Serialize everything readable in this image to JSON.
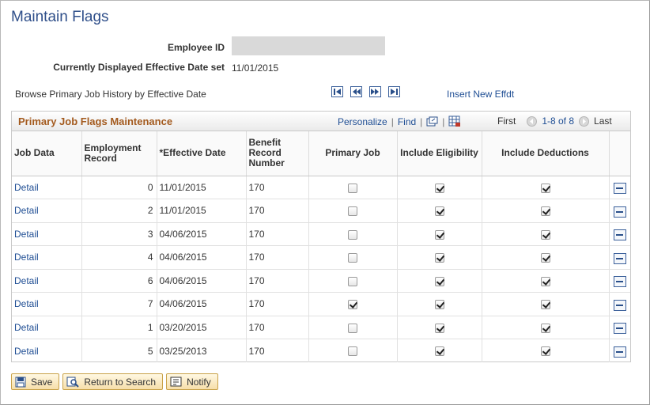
{
  "page": {
    "title": "Maintain Flags",
    "employee_id_label": "Employee ID",
    "employee_id_value": "",
    "effective_date_set_label": "Currently Displayed Effective Date set",
    "effective_date_set_value": "11/01/2015",
    "browse_label": "Browse Primary Job History by Effective Date",
    "insert_link": "Insert New Effdt"
  },
  "nav_icons": [
    "first-record-icon",
    "previous-record-icon",
    "next-record-icon",
    "last-record-icon"
  ],
  "grid": {
    "title": "Primary Job Flags Maintenance",
    "personalize": "Personalize",
    "separator": "|",
    "find": "Find",
    "first": "First",
    "range": "1-8 of 8",
    "last": "Last",
    "columns": {
      "job_data": "Job Data",
      "employment_record": "Employment Record",
      "effective_date": "*Effective Date",
      "benefit_record_number": "Benefit Record Number",
      "primary_job": "Primary Job",
      "include_eligibility": "Include Eligibility",
      "include_deductions": "Include Deductions"
    },
    "rows": [
      {
        "link": "Detail",
        "emp_rcd": "0",
        "eff_date": "11/01/2015",
        "ben_rcd": "170",
        "primary_job": false,
        "eligibility": true,
        "deductions": true
      },
      {
        "link": "Detail",
        "emp_rcd": "2",
        "eff_date": "11/01/2015",
        "ben_rcd": "170",
        "primary_job": false,
        "eligibility": true,
        "deductions": true
      },
      {
        "link": "Detail",
        "emp_rcd": "3",
        "eff_date": "04/06/2015",
        "ben_rcd": "170",
        "primary_job": false,
        "eligibility": true,
        "deductions": true
      },
      {
        "link": "Detail",
        "emp_rcd": "4",
        "eff_date": "04/06/2015",
        "ben_rcd": "170",
        "primary_job": false,
        "eligibility": true,
        "deductions": true
      },
      {
        "link": "Detail",
        "emp_rcd": "6",
        "eff_date": "04/06/2015",
        "ben_rcd": "170",
        "primary_job": false,
        "eligibility": true,
        "deductions": true
      },
      {
        "link": "Detail",
        "emp_rcd": "7",
        "eff_date": "04/06/2015",
        "ben_rcd": "170",
        "primary_job": true,
        "eligibility": true,
        "deductions": true
      },
      {
        "link": "Detail",
        "emp_rcd": "1",
        "eff_date": "03/20/2015",
        "ben_rcd": "170",
        "primary_job": false,
        "eligibility": true,
        "deductions": true
      },
      {
        "link": "Detail",
        "emp_rcd": "5",
        "eff_date": "03/25/2013",
        "ben_rcd": "170",
        "primary_job": false,
        "eligibility": true,
        "deductions": true
      }
    ]
  },
  "buttons": {
    "save": "Save",
    "return_to_search": "Return to Search",
    "notify": "Notify"
  },
  "colors": {
    "title_blue": "#2f4f8a",
    "link_blue": "#1f4e94",
    "grid_title_orange": "#a35a1e",
    "button_gold": "#f6deaa"
  }
}
